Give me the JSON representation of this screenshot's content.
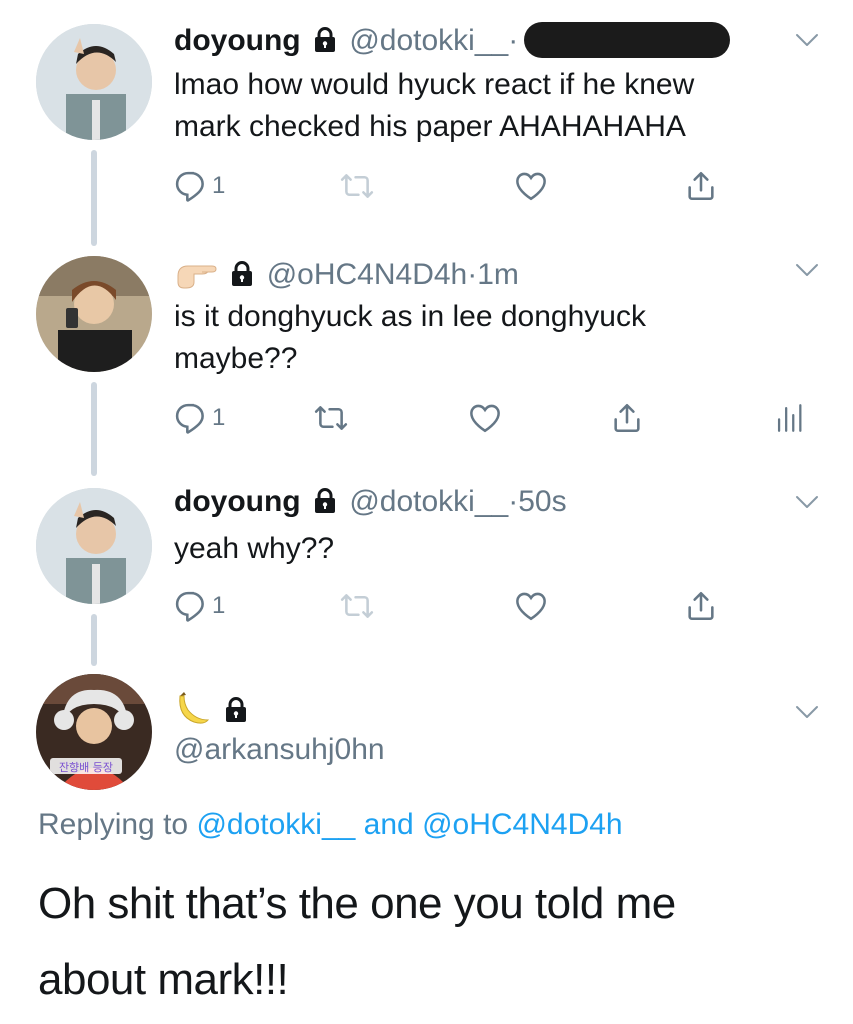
{
  "tweets": [
    {
      "name": "doyoung",
      "handle": "@dotokki__",
      "separator": "·",
      "text_line1": "lmao how would hyuck react if he knew",
      "text_line2": "mark checked his paper AHAHAHAHA",
      "reply_count": "1",
      "avatar_icon": "avatar-doyoung"
    },
    {
      "name_emoji": "pointing-hand-emoji",
      "handle": "@oHC4N4D4h",
      "separator": "·",
      "time": "1m",
      "text_line1": "is it donghyuck as in lee donghyuck",
      "text_line2": "maybe??",
      "reply_count": "1",
      "avatar_icon": "avatar-ohc"
    },
    {
      "name": "doyoung",
      "handle": "@dotokki__",
      "separator": "·",
      "time": "50s",
      "text_line1": "yeah why??",
      "reply_count": "1",
      "avatar_icon": "avatar-doyoung"
    }
  ],
  "focused": {
    "name_emoji": "banana-emoji",
    "handle": "@arkansuhj0hn",
    "avatar_text": "잔향배 등장",
    "replying_prefix": "Replying to",
    "replying_user1": "@dotokki__",
    "replying_and": "and",
    "replying_user2": "@oHC4N4D4h",
    "text_line1": "Oh shit that’s the one you told me",
    "text_line2": "about mark!!!"
  },
  "colors": {
    "accent": "#1da1f2",
    "secondary_text": "#657786",
    "thread_line": "#cdd6df"
  }
}
